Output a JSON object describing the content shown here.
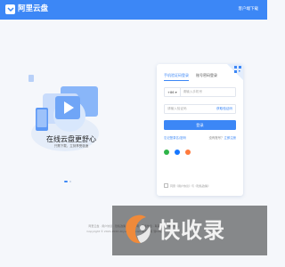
{
  "app": {
    "name": "阿里云盘",
    "client_download": "客户端下载"
  },
  "hero": {
    "title": "在线云盘更舒心",
    "subtitle": "只需下载，立刻享受极速"
  },
  "login": {
    "tabs": [
      "手机验证码登录",
      "账号密码登录"
    ],
    "country_code": "+86 ▾",
    "phone_placeholder": "请输入手机号",
    "code_placeholder": "请输入验证码",
    "get_code": "获取验证码",
    "submit": "登录",
    "forgot": "忘记登录名/密码",
    "no_account": "没有账号？",
    "register": "立即注册",
    "agreement": "同意《用户协议》与《隐私政策》"
  },
  "footer": {
    "line1": "阿里云盘 · 用户协议 · 隐私政策 · 权限说明 · 备案信息 · 联系我们 · 举报中心",
    "line2": "Copyright © 2021-2022 Aliyundrive.com 版权所有 浙ICP备XXXXXXXX号"
  },
  "watermark": {
    "text": "快收录"
  },
  "colors": {
    "primary": "#3c87f6",
    "background": "#f5f7fb"
  }
}
